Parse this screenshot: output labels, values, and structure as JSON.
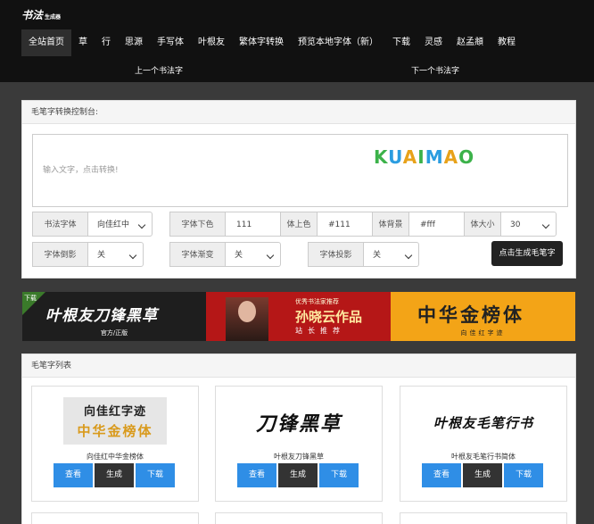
{
  "logo": {
    "text": "书法",
    "sub": "生成器"
  },
  "nav": [
    "全站首页",
    "草",
    "行",
    "思源",
    "手写体",
    "叶根友",
    "繁体字转换",
    "预览本地字体（新）",
    "下载",
    "灵感",
    "赵孟頫",
    "教程"
  ],
  "subnav": {
    "prev": "上一个书法字",
    "next": "下一个书法字"
  },
  "control": {
    "title": "毛笔字转换控制台:",
    "placeholder": "输入文字，点击转换!",
    "font_label": "书法字体",
    "font_value": "向佳红中",
    "fg_label": "字体下色",
    "fg_value": "111",
    "top_label": "体上色",
    "top_value": "#111",
    "bg_label": "体背景",
    "bg_value": "#fff",
    "size_label": "体大小",
    "size_value": "30",
    "shadow_label": "字体倒影",
    "shadow_value": "关",
    "grad_label": "字体渐变",
    "grad_value": "关",
    "proj_label": "字体投影",
    "proj_value": "关",
    "generate_label": "点击生成毛笔字",
    "watermark": "KUAIMAO"
  },
  "banners": {
    "b1": {
      "corner": "下载",
      "title": "叶根友刀锋黑草",
      "sub": "官方/正版"
    },
    "b2": {
      "pre": "优秀书法家推荐",
      "title": "孙晓云作品",
      "sub": "站长推荐"
    },
    "b3": {
      "title": "中华金榜体",
      "sub": "向佳红字迹"
    }
  },
  "list": {
    "title": "毛笔字列表",
    "cards": [
      {
        "preview1": "向佳红字迹",
        "preview2": "中华金榜体",
        "name": "向佳红中华金榜体",
        "view": "查看",
        "gen": "生成",
        "down": "下载"
      },
      {
        "preview1": "刀锋黑草",
        "preview2": "",
        "name": "叶根友刀锋黑草",
        "view": "查看",
        "gen": "生成",
        "down": "下载"
      },
      {
        "preview1": "叶根友毛笔行书",
        "preview2": "",
        "name": "叶根友毛笔行书简体",
        "view": "查看",
        "gen": "生成",
        "down": "下载"
      }
    ]
  },
  "colors": {
    "header": "#111111",
    "accent_blue": "#2f8ee6",
    "dark_button": "#333333",
    "page_bg": "#3a3a3a"
  }
}
